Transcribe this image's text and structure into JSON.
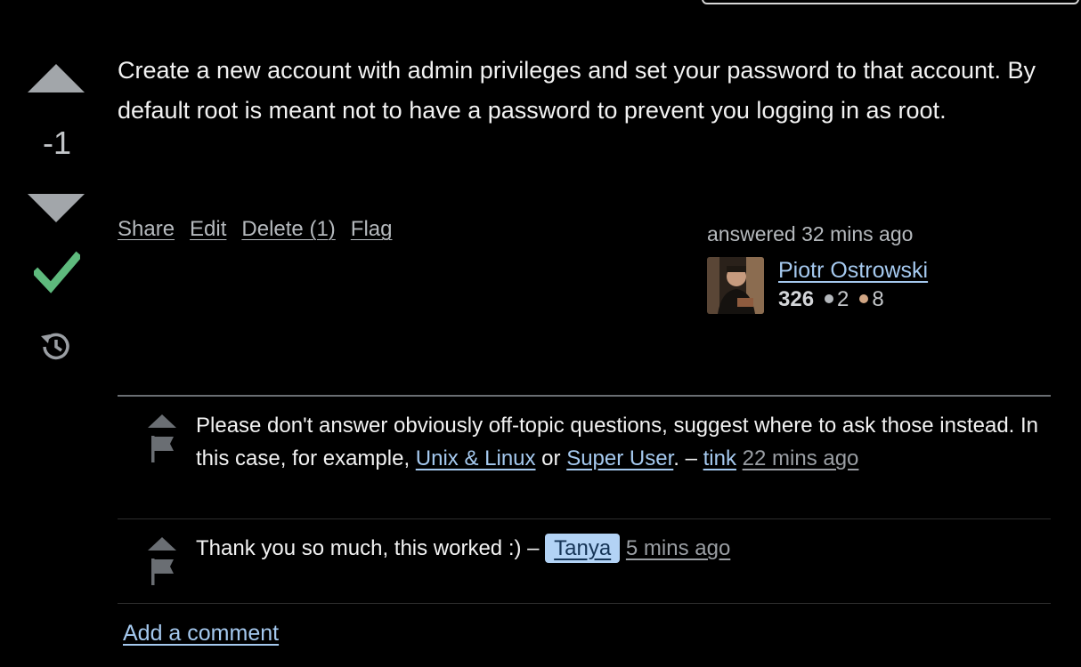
{
  "vote": {
    "score": "-1",
    "accepted": true
  },
  "answer": {
    "body": "Create a new account with admin privileges and set your password to that account. By default root is meant not to have a password to prevent you logging in as root."
  },
  "post_menu": {
    "share": "Share",
    "edit": "Edit",
    "delete": "Delete (1)",
    "flag": "Flag"
  },
  "author": {
    "answered": "answered 32 mins ago",
    "name": "Piotr Ostrowski",
    "reputation": "326",
    "silver_badges": "2",
    "bronze_badges": "8"
  },
  "comments": [
    {
      "text_before": "Please don't answer obviously off-topic questions, suggest where to ask those instead. In this case, for example, ",
      "link1": "Unix & Linux",
      "mid": " or ",
      "link2": "Super User",
      "text_after": ". – ",
      "user": "tink",
      "time": "22 mins ago"
    },
    {
      "text": "Thank you so much, this worked :) – ",
      "user": "Tanya",
      "time": "5 mins ago"
    }
  ],
  "add_comment": "Add a comment",
  "colors": {
    "background": "#000000",
    "link": "#a5c9ef",
    "accepted_check": "#5eba7d",
    "op_badge": "#b3d3f5"
  },
  "icons": [
    "vote-up-icon",
    "vote-down-icon",
    "accepted-check-icon",
    "history-icon",
    "comment-upvote-icon",
    "flag-icon"
  ]
}
